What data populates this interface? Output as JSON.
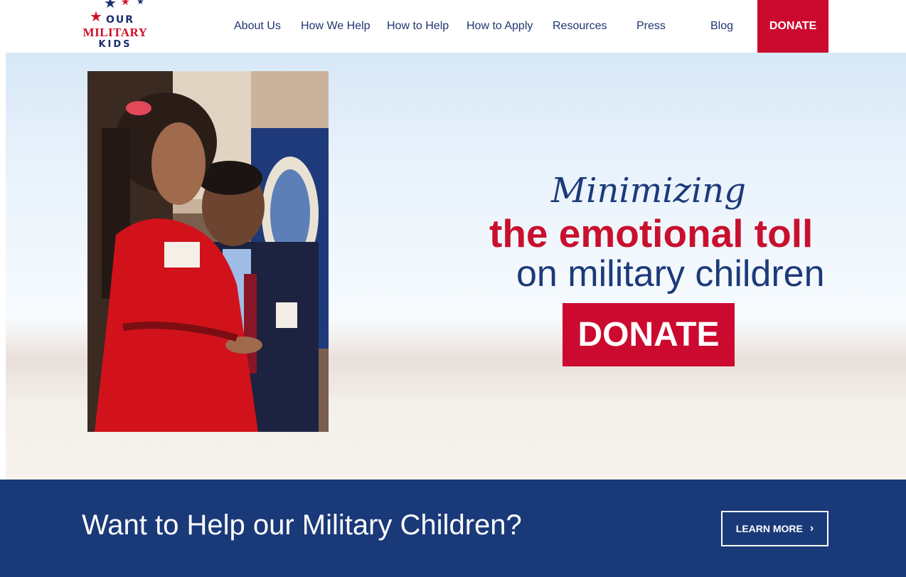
{
  "logo": {
    "line1": "OUR",
    "line2": "MILITARY",
    "line3": "KIDS"
  },
  "nav": {
    "items": [
      {
        "label": "About Us"
      },
      {
        "label": "How We Help"
      },
      {
        "label": "How to Help"
      },
      {
        "label": "How to Apply"
      },
      {
        "label": "Resources"
      },
      {
        "label": "Press"
      },
      {
        "label": "Blog"
      }
    ],
    "donate_label": "DONATE"
  },
  "hero": {
    "line1": "Minimizing",
    "line2": "the emotional toll",
    "line3": "on military children",
    "donate_label": "DONATE"
  },
  "band": {
    "title": "Want to Help our Military Children?",
    "button_label": "LEARN MORE"
  },
  "colors": {
    "brand_red": "#cc0a2f",
    "brand_navy": "#1a3978",
    "nav_text": "#1f3570"
  },
  "icons": {
    "logo_stars": "star-icon",
    "learn_more": "chevron-right-icon"
  }
}
